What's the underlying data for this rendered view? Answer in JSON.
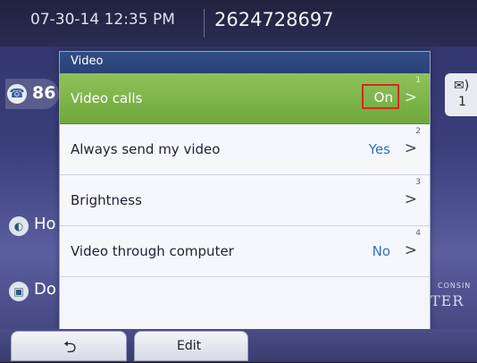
{
  "status_bar": {
    "datetime": "07-30-14 12:35 PM",
    "phone_number": "2624728697"
  },
  "background": {
    "line_ext": "86",
    "item_1": "Ho",
    "item_2": "Do",
    "message_count": "1",
    "logo_small": "CONSIN",
    "logo_large": "TER"
  },
  "menu": {
    "title": "Video",
    "items": [
      {
        "label": "Video calls",
        "value": "On",
        "index": "1",
        "selected": true
      },
      {
        "label": "Always send my video",
        "value": "Yes",
        "index": "2"
      },
      {
        "label": "Brightness",
        "value": "",
        "index": "3"
      },
      {
        "label": "Video through computer",
        "value": "No",
        "index": "4"
      }
    ]
  },
  "softkeys": {
    "back_glyph": "⮌",
    "edit_label": "Edit"
  },
  "colors": {
    "selected_row": "#7db44a",
    "highlight_box": "#d9281f",
    "value_text": "#2e72c9",
    "header": "#2f4e86"
  }
}
